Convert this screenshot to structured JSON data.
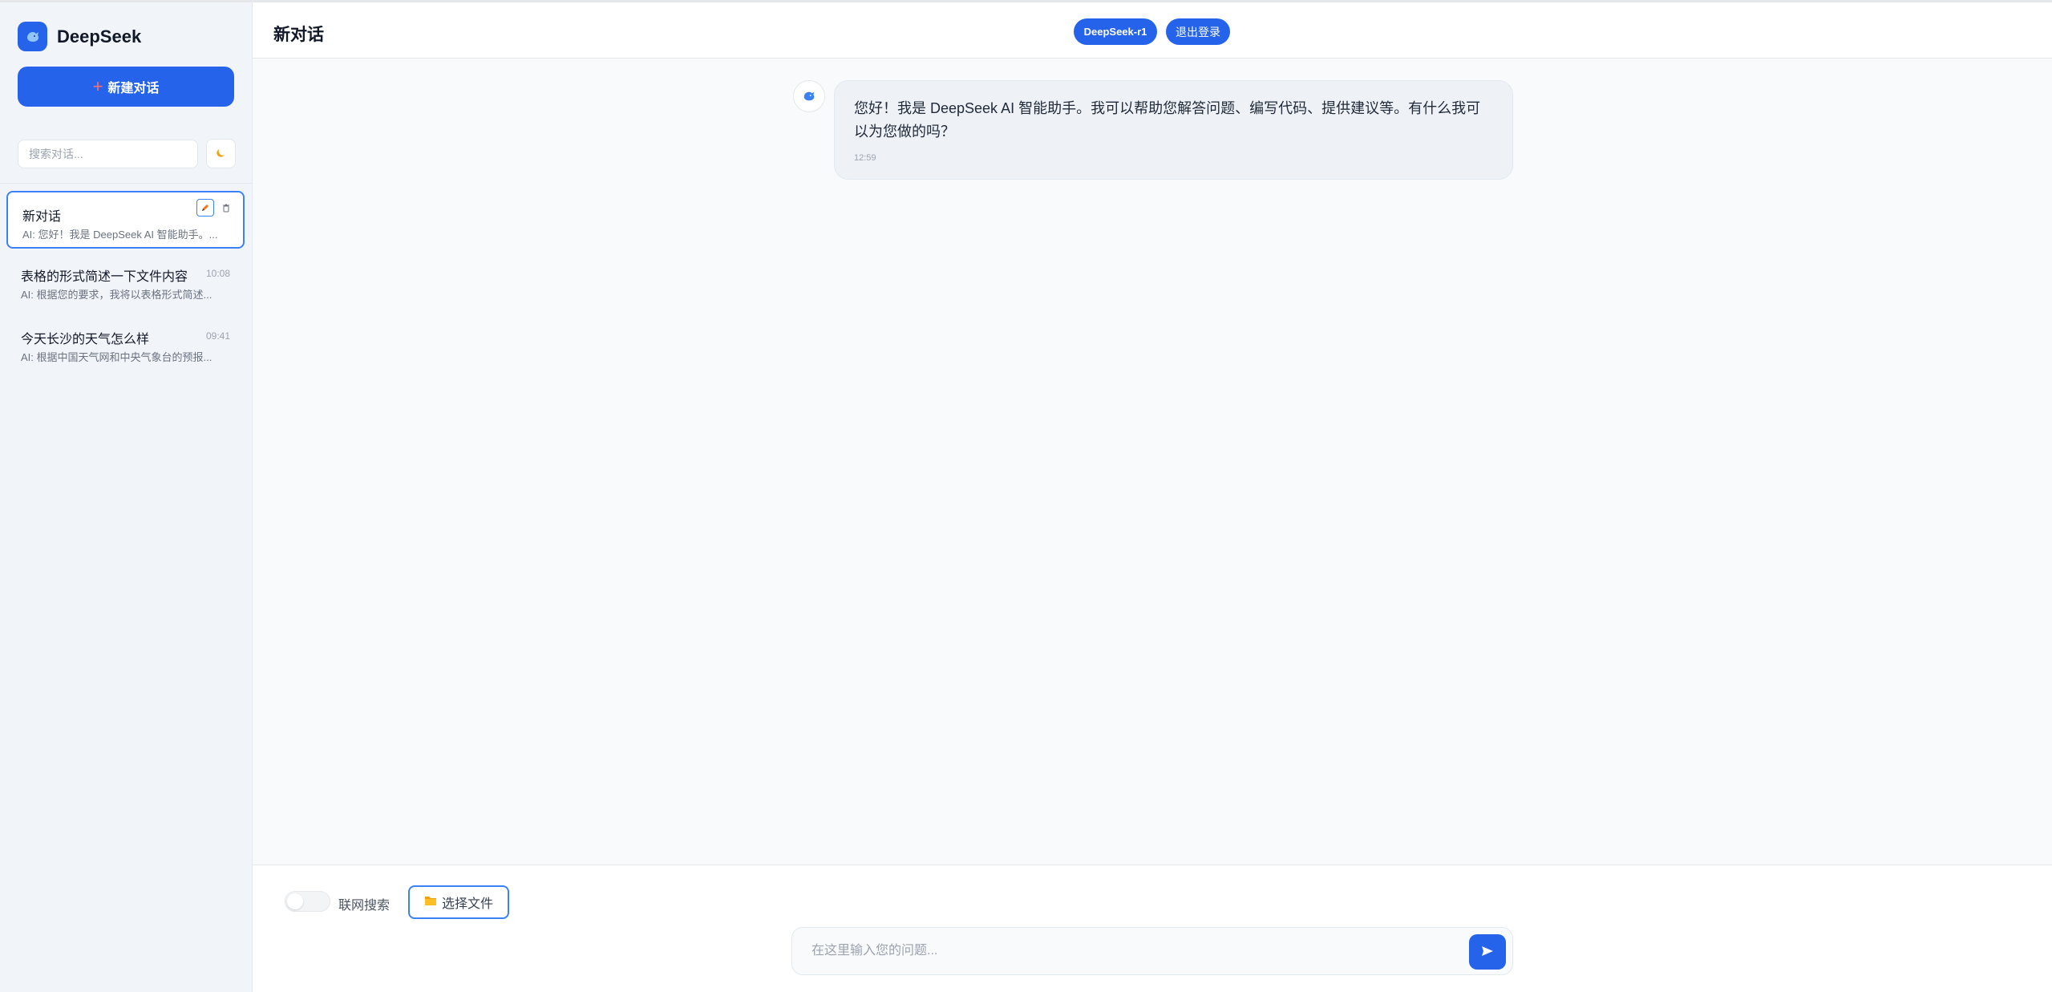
{
  "app": {
    "name": "DeepSeek",
    "logo_icon": "whale-icon",
    "accent": "#2563eb"
  },
  "sidebar": {
    "new_chat_label": "新建对话",
    "search_placeholder": "搜索对话...",
    "theme_icon": "moon-icon",
    "conversations": [
      {
        "title": "新对话",
        "time": "",
        "preview": "AI: 您好！我是 DeepSeek AI 智能助手。...",
        "active": true
      },
      {
        "title": "表格的形式简述一下文件内容",
        "time": "10:08",
        "preview": "AI: 根据您的要求，我将以表格形式简述...",
        "active": false
      },
      {
        "title": "今天长沙的天气怎么样",
        "time": "09:41",
        "preview": "AI: 根据中国天气网和中央气象台的预报...",
        "active": false
      }
    ]
  },
  "header": {
    "title": "新对话",
    "model_label": "DeepSeek-r1",
    "logout_label": "退出登录"
  },
  "messages": [
    {
      "role": "assistant",
      "text": "您好！我是 DeepSeek AI 智能助手。我可以帮助您解答问题、编写代码、提供建议等。有什么我可以为您做的吗？",
      "time": "12:59"
    }
  ],
  "composer": {
    "web_search_label": "联网搜索",
    "web_search_enabled": false,
    "file_button_label": "选择文件",
    "input_placeholder": "在这里输入您的问题...",
    "send_icon": "send-icon"
  }
}
